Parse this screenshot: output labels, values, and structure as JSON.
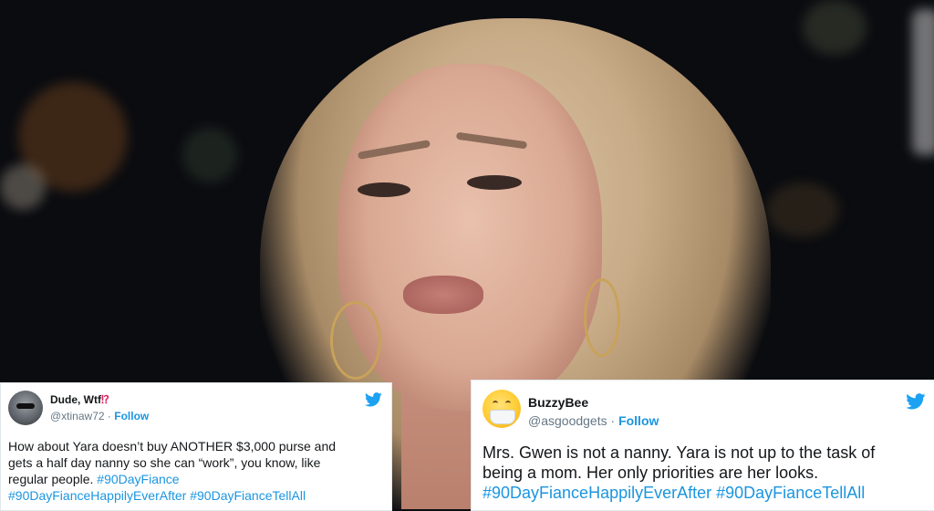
{
  "tweets": [
    {
      "display_name": "Dude, Wtf",
      "name_emoji": "⁉",
      "handle": "@xtinaw72",
      "separator": "·",
      "follow_label": "Follow",
      "avatar_icon": "avatar-sunglasses-icon",
      "platform_icon": "twitter-bird-icon",
      "text_line1": "How about Yara doesn’t buy ANOTHER $3,000 purse and",
      "text_line2": "gets a half day nanny so she can “work”, you know, like",
      "text_line3_plain": "regular people. ",
      "hashtag1": "#90DayFiance",
      "hashtag2": "#90DayFianceHappilyEverAfter",
      "hashtag3": "#90DayFianceTellAll"
    },
    {
      "display_name": "BuzzyBee",
      "handle": "@asgoodgets",
      "separator": "·",
      "follow_label": "Follow",
      "avatar_icon": "face-with-medical-mask-emoji-icon",
      "platform_icon": "twitter-bird-icon",
      "text_line1": "Mrs. Gwen is not a nanny. Yara is not up to the task of",
      "text_line2": "being a mom. Her only priorities are her looks.",
      "hashtag1": "#90DayFianceHappilyEverAfter",
      "hashtag2": "#90DayFianceTellAll"
    }
  ],
  "colors": {
    "link": "#1b95e0",
    "text": "#14171a",
    "muted": "#657786",
    "background_dark": "#0b0c10"
  }
}
